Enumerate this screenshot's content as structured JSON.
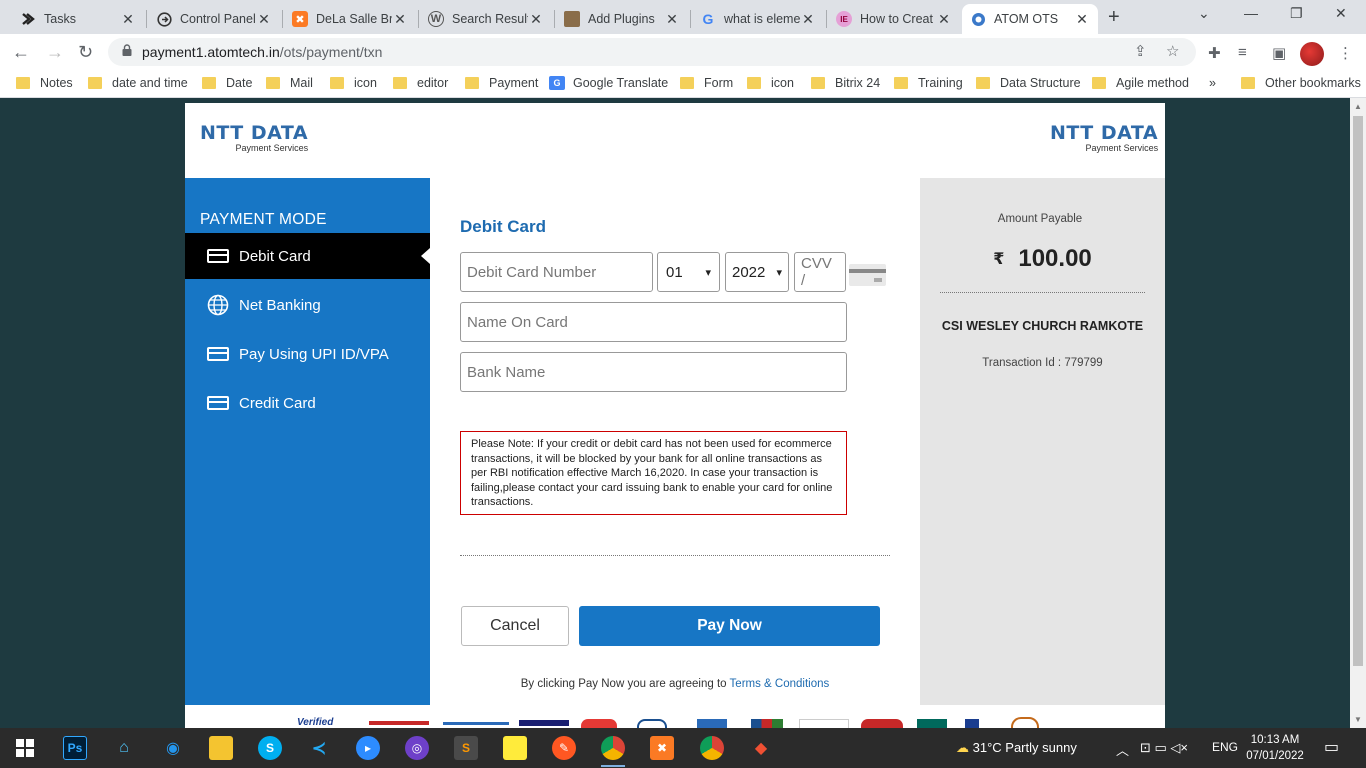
{
  "browser": {
    "tabs": [
      {
        "label": "Tasks",
        "icon": "tasks-icon",
        "active": false
      },
      {
        "label": "Control Panel",
        "icon": "control-panel-icon",
        "active": false
      },
      {
        "label": "DeLa Salle Br",
        "icon": "xampp-icon",
        "active": false
      },
      {
        "label": "Search Result",
        "icon": "wordpress-icon",
        "active": false
      },
      {
        "label": "Add Plugins",
        "icon": "plugins-icon",
        "active": false
      },
      {
        "label": "what is eleme",
        "icon": "google-icon",
        "active": false
      },
      {
        "label": "How to Creat",
        "icon": "elementor-icon",
        "active": false
      },
      {
        "label": "ATOM OTS",
        "icon": "atom-icon",
        "active": true
      }
    ],
    "url_domain": "payment1.atomtech.in",
    "url_path": "/ots/payment/txn",
    "bookmarks": [
      {
        "label": "Notes",
        "icon": "folder-icon"
      },
      {
        "label": "date and time",
        "icon": "folder-icon"
      },
      {
        "label": "Date",
        "icon": "folder-icon"
      },
      {
        "label": "Mail",
        "icon": "folder-icon"
      },
      {
        "label": "icon",
        "icon": "folder-icon"
      },
      {
        "label": "editor",
        "icon": "folder-icon"
      },
      {
        "label": "Payment",
        "icon": "folder-icon"
      },
      {
        "label": "Google Translate",
        "icon": "google-translate-icon"
      },
      {
        "label": "Form",
        "icon": "folder-icon"
      },
      {
        "label": "icon",
        "icon": "folder-icon"
      },
      {
        "label": "Bitrix 24",
        "icon": "folder-icon"
      },
      {
        "label": "Training",
        "icon": "folder-icon"
      },
      {
        "label": "Data Structure",
        "icon": "folder-icon"
      },
      {
        "label": "Agile method",
        "icon": "folder-icon"
      }
    ],
    "more_bookmarks": "»",
    "other_bookmarks": "Other bookmarks"
  },
  "page": {
    "logo": {
      "brand": "NTT DATA",
      "sub": "Payment Services"
    },
    "sidebar": {
      "title": "PAYMENT MODE",
      "items": [
        {
          "label": "Debit Card",
          "icon": "card-icon",
          "active": true
        },
        {
          "label": "Net Banking",
          "icon": "globe-icon",
          "active": false
        },
        {
          "label": "Pay Using UPI ID/VPA",
          "icon": "card-icon",
          "active": false
        },
        {
          "label": "Credit Card",
          "icon": "card-icon",
          "active": false
        }
      ]
    },
    "form": {
      "heading": "Debit Card",
      "card_number_placeholder": "Debit Card Number",
      "month": "01",
      "year": "2022",
      "cvv_placeholder": "CVV /",
      "name_placeholder": "Name On Card",
      "bank_placeholder": "Bank Name",
      "note": "Please Note: If your credit or debit card has not been used for ecommerce transactions, it will be blocked by your bank for all online transactions as per RBI notification effective March 16,2020. In case your transaction is failing,please contact your card issuing bank to enable your card for online transactions.",
      "cancel_label": "Cancel",
      "pay_label": "Pay Now",
      "terms_prefix": "By clicking Pay Now you are agreeing to",
      "terms_link": "Terms & Conditions"
    },
    "summary": {
      "amount_label": "Amount Payable",
      "currency": "₹",
      "amount": "100.00",
      "merchant": "CSI WESLEY CHURCH RAMKOTE",
      "transaction": "Transaction Id : 779799"
    },
    "footer_logos": [
      "Verified by VISA",
      "MasterCard SecureCode",
      "AMERICAN EXPRESS",
      "visa",
      "mastercard",
      "diners",
      "amex",
      "jcb",
      "rupay",
      "maestro",
      "secure",
      "bank"
    ]
  },
  "taskbar": {
    "apps": [
      "windows-start-icon",
      "photoshop-icon",
      "network-icon",
      "docker-icon",
      "file-explorer-icon",
      "skype-icon",
      "vscode-icon",
      "zoom-icon",
      "github-icon",
      "sublime-icon",
      "sticky-notes-icon",
      "paint-icon",
      "chrome-icon",
      "xampp-icon",
      "chrome-alt-icon",
      "git-icon"
    ],
    "weather": "31°C  Partly sunny",
    "language": "ENG",
    "time": "10:13 AM",
    "date": "07/01/2022",
    "colors": {
      "accent": "#1776c5",
      "sidebar_active": "#000000",
      "note_border": "#cc0000"
    }
  }
}
